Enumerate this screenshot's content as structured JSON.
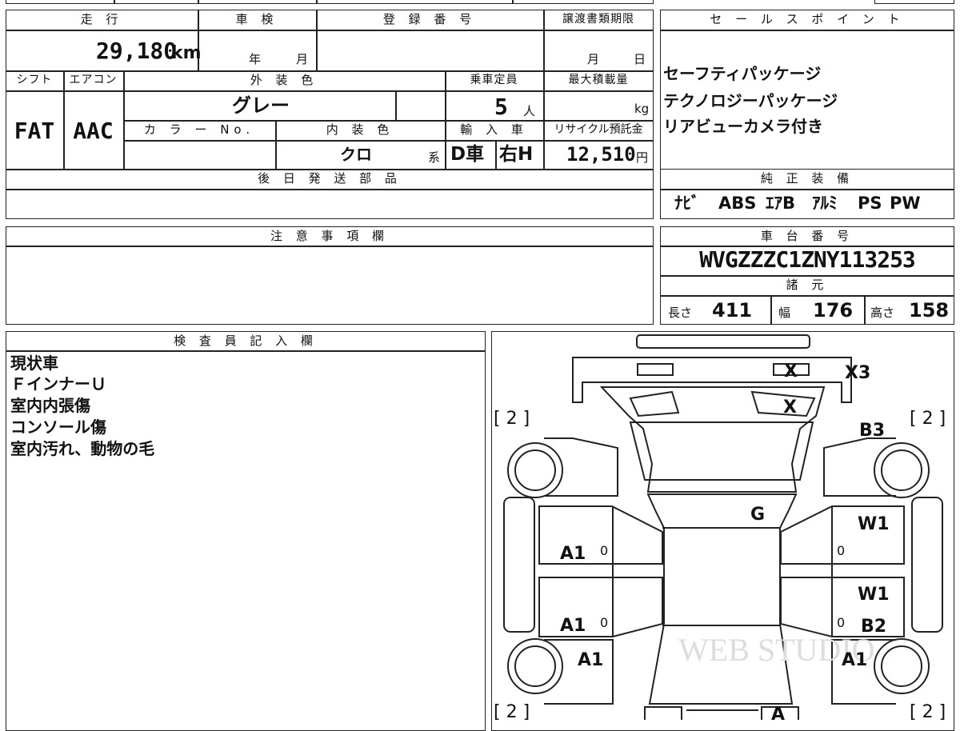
{
  "top_box": {
    "mileage_header": "走 行",
    "shaken_header": "車 検",
    "registration_header": "登 録 番 号",
    "transfer_header": "譲渡書類期限",
    "mileage_value": "29,180",
    "mileage_unit": "km",
    "year_label": "年",
    "month_label": "月",
    "transfer_month": "月",
    "transfer_day": "日",
    "shift_header": "シフト",
    "aircon_header": "エアコン",
    "exterior_color_header": "外 装 色",
    "capacity_header": "乗車定員",
    "max_load_header": "最大積載量",
    "shift_value": "FAT",
    "aircon_value": "AAC",
    "exterior_color_value": "グレー",
    "capacity_value": "5",
    "capacity_unit": "人",
    "load_unit": "kg",
    "color_no_header": "カ ラ ー No.",
    "interior_color_header": "内 装 色",
    "import_header": "輸 入 車",
    "recycle_header": "リサイクル預託金",
    "interior_color_value": "クロ",
    "interior_color_suffix": "系",
    "import_value_1": "D車",
    "import_value_2": "右H",
    "recycle_value": "12,510",
    "recycle_unit": "円",
    "later_parts_header": "後 日 発 送 部 品"
  },
  "sales_points": {
    "header": "セ ー ル ス ポ イ ン ト",
    "items": [
      "セーフティパッケージ",
      "テクノロジーパッケージ",
      "リアビューカメラ付き"
    ]
  },
  "equipment": {
    "header": "純 正 装 備",
    "items": [
      "ﾅﾋﾞ",
      "ABS",
      "ｴｱB",
      "ｱﾙﾐ",
      "PS",
      "PW"
    ]
  },
  "notes": {
    "header": "注 意 事 項 欄"
  },
  "chassis": {
    "header": "車 台 番 号",
    "number": "WVGZZZC1ZNY113253",
    "specs_header": "諸 元",
    "length_label": "長さ",
    "length_value": "411",
    "width_label": "幅",
    "width_value": "176",
    "height_label": "高さ",
    "height_value": "158"
  },
  "inspector": {
    "header": "検 査 員 記 入 欄",
    "lines": [
      "現状車",
      "ＦインナーＵ",
      "室内内張傷",
      "コンソール傷",
      "室内汚れ、動物の毛"
    ]
  },
  "diagram": {
    "marks": {
      "x_top": "X",
      "x3": "X3",
      "x_hood": "X",
      "b3": "B3",
      "bracket_fl": "[ 2 ]",
      "bracket_fr": "[ 2 ]",
      "g_windshield": "G",
      "a1_front_left_door": "A1",
      "a1_rear_left_door": "A1",
      "a1_rear_left_fender": "A1",
      "w1_front_right_door": "W1",
      "w1_rear_right_door": "W1",
      "b2_rear_right_door": "B2",
      "a1_rear_right_fender": "A1",
      "bracket_rl": "[ 2 ]",
      "bracket_rr": "[ 2 ]",
      "a_rear": "A",
      "zero_1": "0",
      "zero_2": "0",
      "zero_3": "0",
      "zero_4": "0"
    },
    "watermark": "WEB STUDIO"
  }
}
